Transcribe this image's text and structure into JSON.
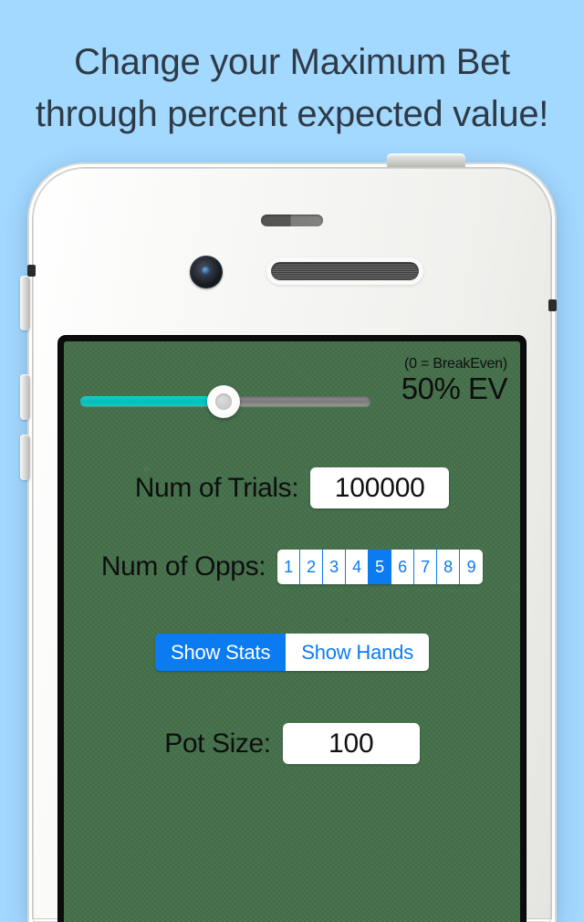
{
  "headline": {
    "line1": "Change your Maximum Bet",
    "line2": "through percent expected value!"
  },
  "colors": {
    "background": "#a3d8ff",
    "headline_text": "#2e3b47",
    "felt_green": "#44704a",
    "accent_blue": "#0b7bf1",
    "slider_fill_teal": "#0cc3be",
    "phone_body": "#f3f3f0"
  },
  "app": {
    "ev_control": {
      "note": "(0 = BreakEven)",
      "value_label": "50% EV",
      "percent": 50,
      "slider_position_percent": 49
    },
    "trials": {
      "label": "Num of Trials:",
      "value": "100000"
    },
    "opps": {
      "label": "Num of Opps:",
      "options": [
        "1",
        "2",
        "3",
        "4",
        "5",
        "6",
        "7",
        "8",
        "9"
      ],
      "selected": "5"
    },
    "view_toggle": {
      "options": [
        "Show Stats",
        "Show Hands"
      ],
      "selected": "Show Stats"
    },
    "pot": {
      "label": "Pot Size:",
      "value": "100"
    }
  }
}
